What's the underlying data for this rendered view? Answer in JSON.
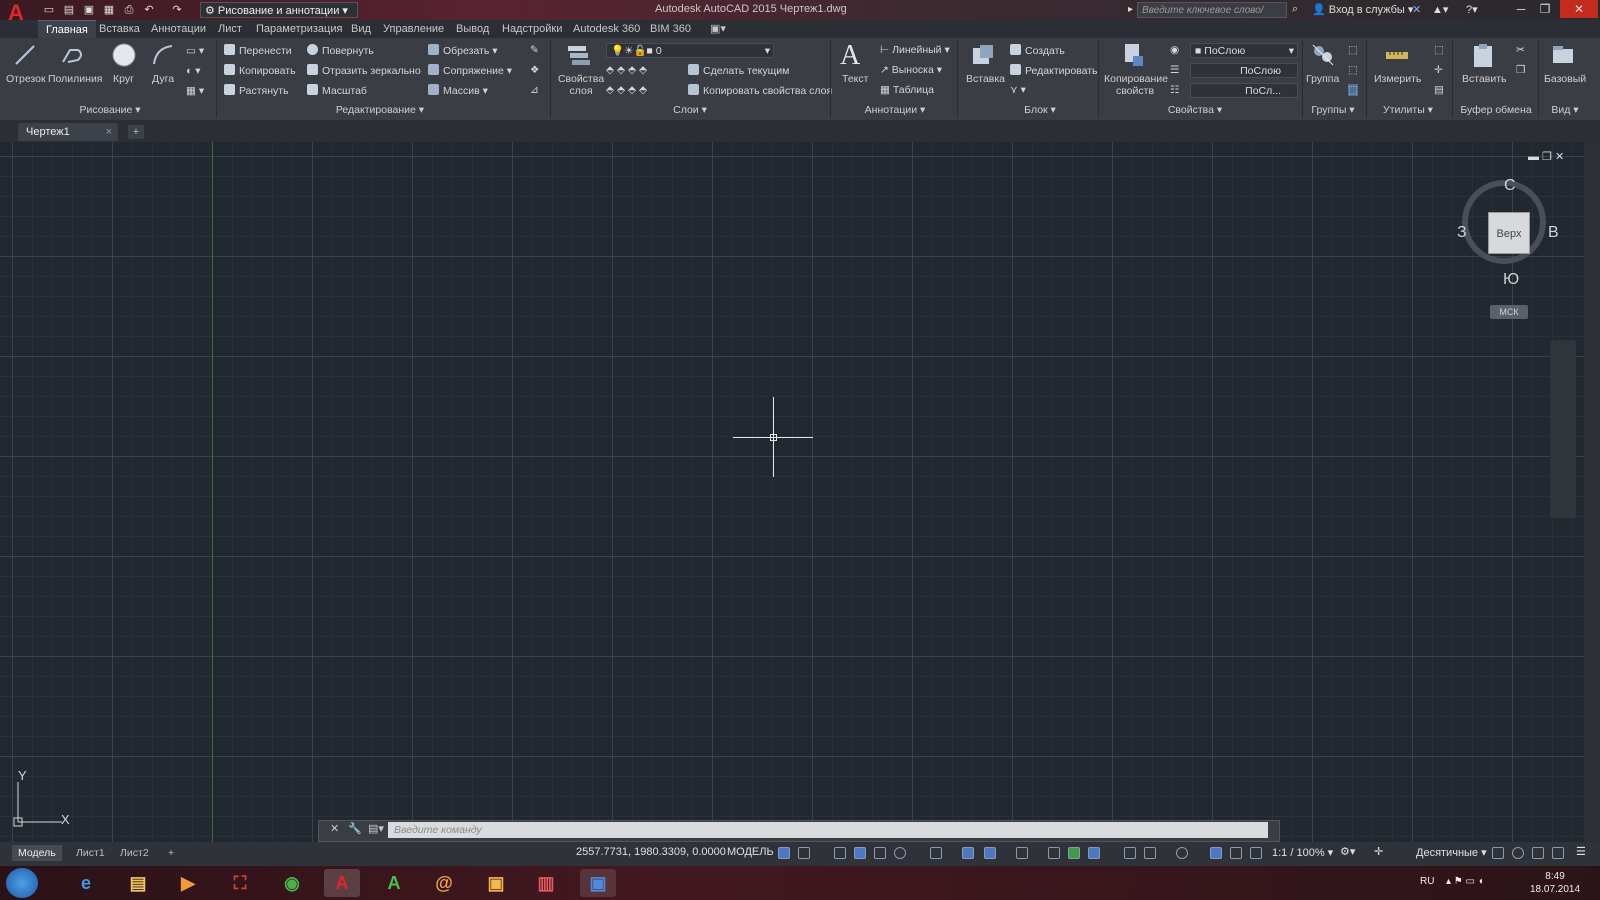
{
  "title_bar": {
    "workspace": "Рисование и аннотации",
    "window_title": "Autodesk AutoCAD 2015   Чертеж1.dwg",
    "search_placeholder": "Введите ключевое слово/фразу",
    "login": "Вход в службы"
  },
  "menu_tabs": [
    "Главная",
    "Вставка",
    "Аннотации",
    "Лист",
    "Параметризация",
    "Вид",
    "Управление",
    "Вывод",
    "Надстройки",
    "Autodesk 360",
    "BIM 360"
  ],
  "ribbon": {
    "draw": {
      "title": "Рисование",
      "line": "Отрезок",
      "polyline": "Полилиния",
      "circle": "Круг",
      "arc": "Дуга"
    },
    "modify": {
      "title": "Редактирование",
      "move": "Перенести",
      "rotate": "Повернуть",
      "trim": "Обрезать",
      "copy": "Копировать",
      "mirror": "Отразить зеркально",
      "fillet": "Сопряжение",
      "stretch": "Растянуть",
      "scale": "Масштаб",
      "array": "Массив"
    },
    "layers": {
      "title": "Слои",
      "properties": "Свойства слоя",
      "current_layer": "0",
      "make_current": "Сделать текущим",
      "match_layer": "Копировать свойства слоя"
    },
    "annotation": {
      "title": "Аннотации",
      "text": "Текст",
      "dim_linear": "Линейный",
      "leader": "Выноска",
      "table": "Таблица"
    },
    "block": {
      "title": "Блок",
      "insert": "Вставка",
      "create": "Создать",
      "edit": "Редактировать"
    },
    "properties": {
      "title": "Свойства",
      "match": "Копирование свойств",
      "color": "ПоСлою",
      "linetype": "ПоСлою",
      "lineweight": "ПоСл..."
    },
    "groups": {
      "title": "Группы",
      "group": "Группа"
    },
    "utilities": {
      "title": "Утилиты",
      "measure": "Измерить"
    },
    "clipboard": {
      "title": "Буфер обмена",
      "paste": "Вставить"
    },
    "view": {
      "title": "Вид",
      "base": "Базовый"
    }
  },
  "document_tab": "Чертеж1",
  "viewcube": {
    "north": "С",
    "south": "Ю",
    "west": "З",
    "east": "В",
    "face": "Верх",
    "wcs": "МСК"
  },
  "ucs": {
    "x": "X",
    "y": "Y"
  },
  "command_line": {
    "placeholder": "Введите команду"
  },
  "layout_tabs": [
    "Модель",
    "Лист1",
    "Лист2"
  ],
  "status": {
    "coords": "2557.7731, 1980.3309, 0.0000",
    "space": "МОДЕЛЬ",
    "scale": "1:1 / 100%",
    "units": "Десятичные"
  },
  "taskbar": {
    "lang": "RU",
    "time": "8:49",
    "date": "18.07.2014"
  }
}
